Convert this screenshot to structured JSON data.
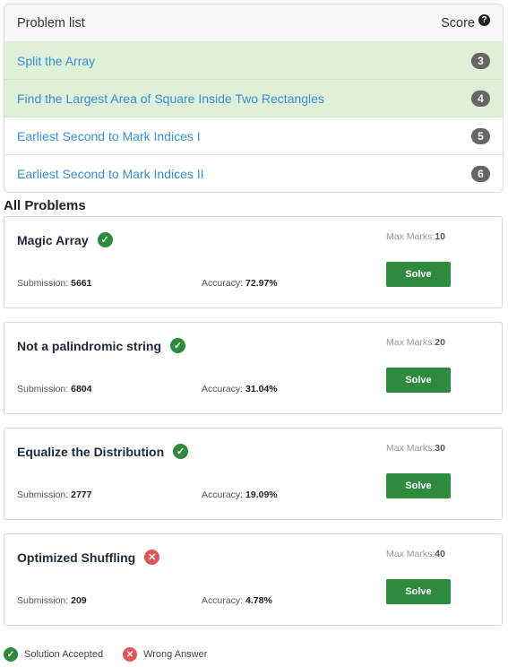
{
  "problem_list": {
    "title": "Problem list",
    "score_label": "Score",
    "rows": [
      {
        "name": "Split the Array",
        "points": "3",
        "solved": true
      },
      {
        "name": "Find the Largest Area of Square Inside Two Rectangles",
        "points": "4",
        "solved": true
      },
      {
        "name": "Earliest Second to Mark Indices I",
        "points": "5",
        "solved": false
      },
      {
        "name": "Earliest Second to Mark Indices II",
        "points": "6",
        "solved": false
      }
    ]
  },
  "all_problems": {
    "title": "All Problems",
    "submission_label": "Submission: ",
    "accuracy_label": "Accuracy: ",
    "max_marks_label": "Max Marks:",
    "solve_label": "Solve",
    "cards": [
      {
        "name": "Magic Array",
        "status": "accepted",
        "max_marks": "10",
        "submissions": "5661",
        "accuracy": "72.97%"
      },
      {
        "name": "Not a palindromic string",
        "status": "accepted",
        "max_marks": "20",
        "submissions": "6804",
        "accuracy": "31.04%"
      },
      {
        "name": "Equalize the Distribution",
        "status": "accepted",
        "max_marks": "30",
        "submissions": "2777",
        "accuracy": "19.09%"
      },
      {
        "name": "Optimized Shuffling",
        "status": "wrong",
        "max_marks": "40",
        "submissions": "209",
        "accuracy": "4.78%"
      }
    ]
  },
  "legend": {
    "accepted_label": "Solution Accepted",
    "wrong_label": "Wrong Answer"
  },
  "colors": {
    "accent_green": "#2f8a3e",
    "solved_row_bg": "#dff0d8",
    "link_blue": "#3a8fd6",
    "wrong_red": "#e05555"
  },
  "icons": {
    "help": "question-circle-icon",
    "accepted": "check-circle-icon",
    "wrong": "x-circle-icon"
  }
}
